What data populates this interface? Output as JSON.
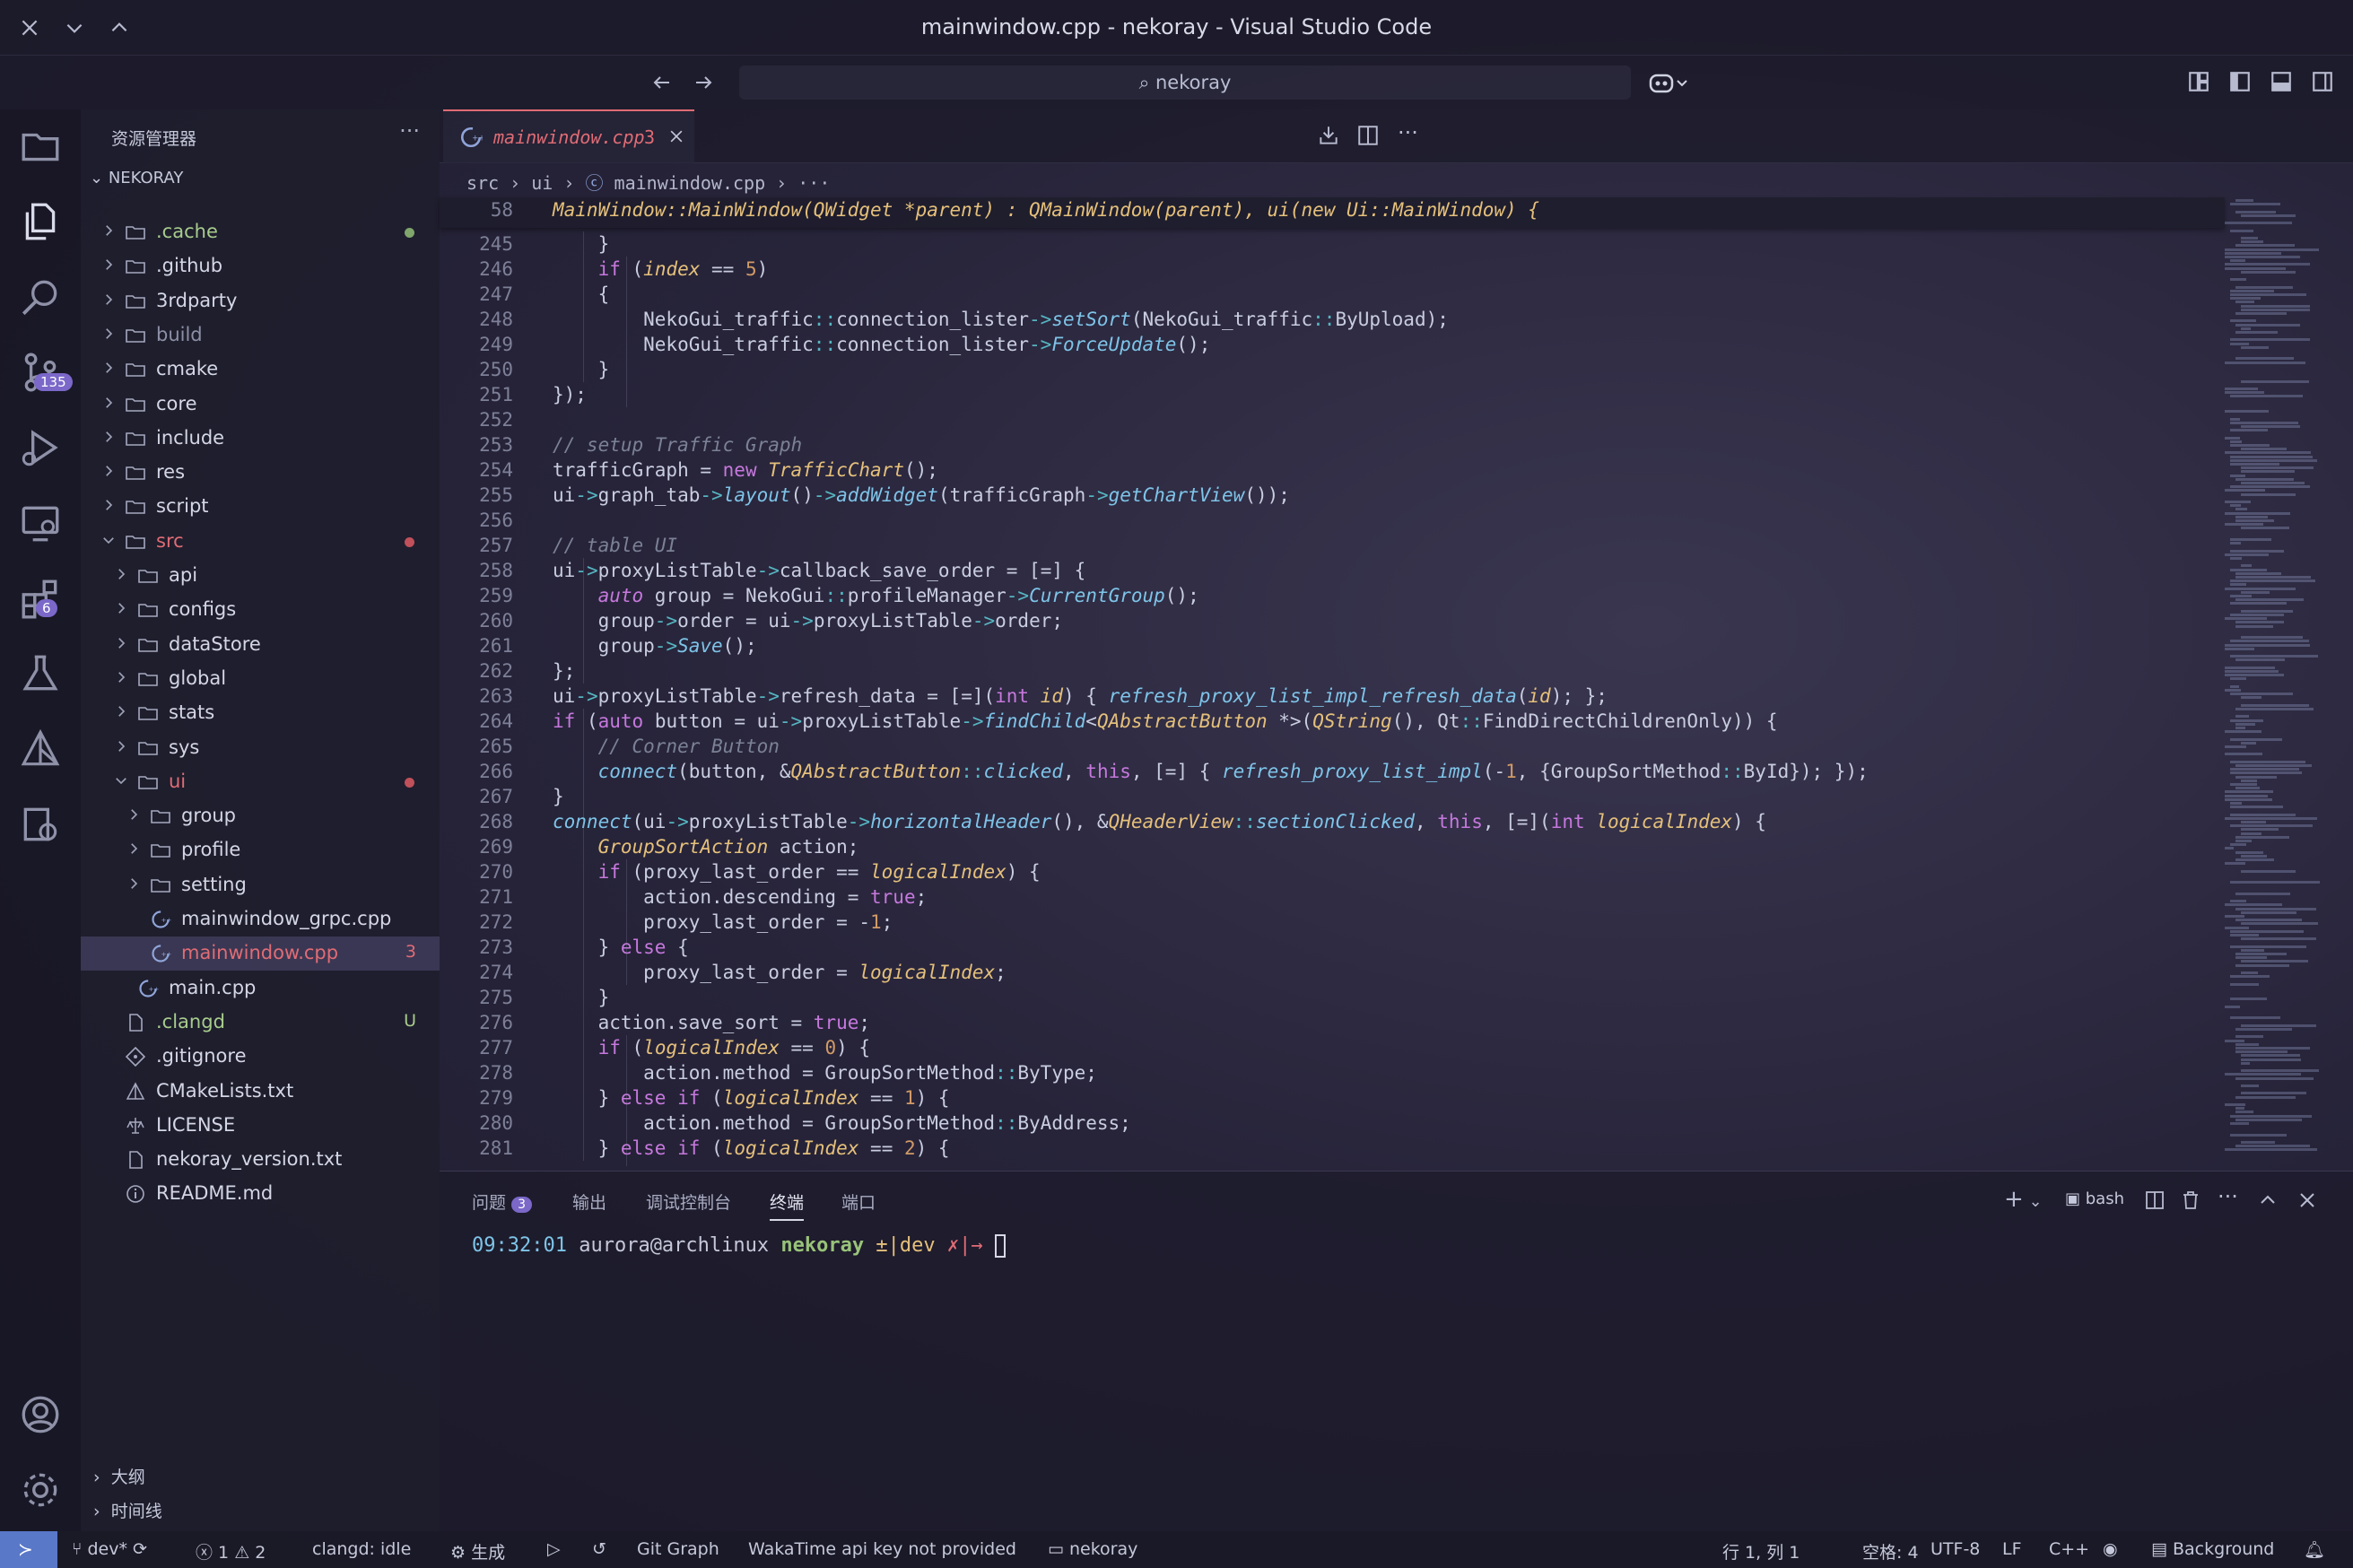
{
  "window": {
    "title": "mainwindow.cpp - nekoray - Visual Studio Code"
  },
  "command_center": {
    "search_text": "nekoray"
  },
  "activity_bar": {
    "scm_badge": "135",
    "extensions_badge": "6"
  },
  "sidebar": {
    "title": "资源管理器",
    "more": "···",
    "root": "NEKORAY",
    "tree": [
      {
        "label": ".cache",
        "dot": "#7fa66b"
      },
      {
        "label": ".github"
      },
      {
        "label": "3rdparty"
      },
      {
        "label": "build",
        "dim": true
      },
      {
        "label": "cmake"
      },
      {
        "label": "core"
      },
      {
        "label": "include"
      },
      {
        "label": "res"
      },
      {
        "label": "script"
      },
      {
        "label": "src",
        "dot": "#c0505a"
      },
      {
        "label": "api"
      },
      {
        "label": "configs"
      },
      {
        "label": "dataStore"
      },
      {
        "label": "global"
      },
      {
        "label": "stats"
      },
      {
        "label": "sys"
      },
      {
        "label": "ui",
        "dot": "#c0505a"
      },
      {
        "label": "group"
      },
      {
        "label": "profile"
      },
      {
        "label": "setting"
      },
      {
        "label": "mainwindow_grpc.cpp"
      },
      {
        "label": "mainwindow.cpp",
        "status": "3"
      },
      {
        "label": "main.cpp"
      },
      {
        "label": ".clangd",
        "status": "U"
      },
      {
        "label": ".gitignore"
      },
      {
        "label": "CMakeLists.txt"
      },
      {
        "label": "LICENSE"
      },
      {
        "label": "nekoray_version.txt"
      },
      {
        "label": "README.md"
      }
    ],
    "outline": "大纲",
    "timeline": "时间线"
  },
  "editor": {
    "tab": {
      "label": "mainwindow.cpp",
      "problems": "3"
    },
    "breadcrumb": [
      "src",
      "ui",
      "mainwindow.cpp",
      "···"
    ],
    "sticky_line_number": "58",
    "sticky_line": "MainWindow::MainWindow(QWidget *parent) : QMainWindow(parent), ui(new Ui::MainWindow) {",
    "line_numbers": [
      "245",
      "246",
      "247",
      "248",
      "249",
      "250",
      "251",
      "252",
      "253",
      "254",
      "255",
      "256",
      "257",
      "258",
      "259",
      "260",
      "261",
      "262",
      "263",
      "264",
      "265",
      "266",
      "267",
      "268",
      "269",
      "270",
      "271",
      "272",
      "273",
      "274",
      "275",
      "276",
      "277",
      "278",
      "279",
      "280",
      "281"
    ]
  },
  "panel": {
    "tabs": [
      {
        "label": "问题",
        "badge": "3"
      },
      {
        "label": "输出"
      },
      {
        "label": "调试控制台"
      },
      {
        "label": "终端",
        "active": true
      },
      {
        "label": "端口"
      }
    ],
    "shell": "bash",
    "terminal": {
      "time": "09:32:01",
      "user": "aurora@archlinux",
      "dir": "nekoray",
      "git": "±|dev",
      "dirty": "✗|→"
    }
  },
  "status_bar": {
    "branch": "dev*",
    "errors": "1",
    "warnings": "2",
    "clangd": "clangd: idle",
    "build": "生成",
    "git_graph": "Git Graph",
    "wakatime": "WakaTime api key not provided",
    "folder": "nekoray",
    "position": "行 1, 列 1",
    "spaces": "空格: 4",
    "encoding": "UTF-8",
    "eol": "LF",
    "language": "C++",
    "background": "Background"
  }
}
